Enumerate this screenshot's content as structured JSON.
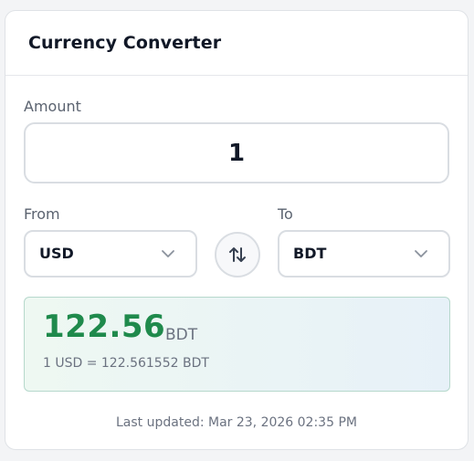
{
  "header": {
    "title": "Currency Converter"
  },
  "amount": {
    "label": "Amount",
    "value": "1"
  },
  "from": {
    "label": "From",
    "selected": "USD"
  },
  "to": {
    "label": "To",
    "selected": "BDT"
  },
  "result": {
    "amount": "122.56",
    "currency": "BDT",
    "rate": "1 USD = 122.561552 BDT"
  },
  "footer": {
    "updated": "Last updated: Mar 23, 2026 02:35 PM"
  },
  "colors": {
    "result_amount": "#1f8a4c",
    "border": "#d9dde2",
    "text_primary": "#111827",
    "text_muted": "#6b7280"
  },
  "icons": {
    "swap": "swap-arrows-icon",
    "dropdown": "chevron-down-icon"
  }
}
